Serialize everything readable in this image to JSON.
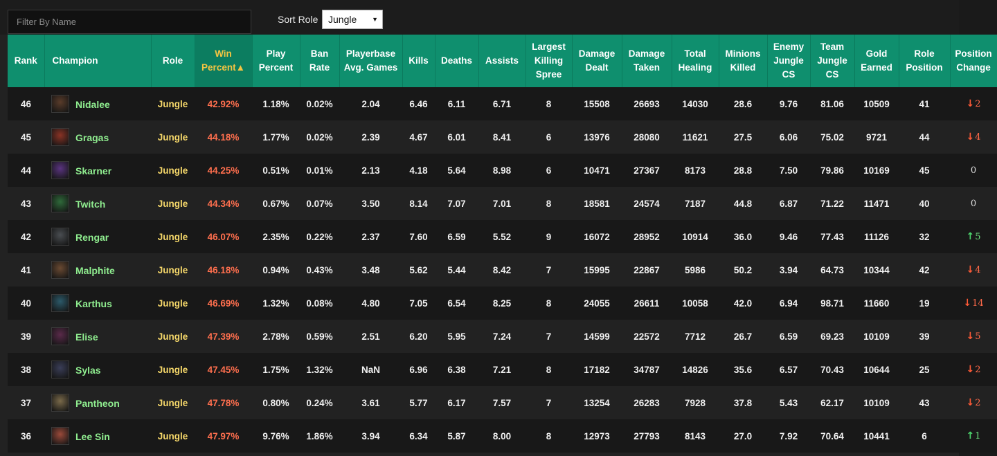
{
  "filter": {
    "placeholder": "Filter By Name",
    "value": ""
  },
  "sort": {
    "label": "Sort Role",
    "selected": "Jungle"
  },
  "columns": [
    {
      "label": "Rank"
    },
    {
      "label": "Champion"
    },
    {
      "label": "Role"
    },
    {
      "label": "Win Percent▲",
      "sorted": true
    },
    {
      "label": "Play Percent"
    },
    {
      "label": "Ban Rate"
    },
    {
      "label": "Playerbase Avg. Games"
    },
    {
      "label": "Kills"
    },
    {
      "label": "Deaths"
    },
    {
      "label": "Assists"
    },
    {
      "label": "Largest Killing Spree"
    },
    {
      "label": "Damage Dealt"
    },
    {
      "label": "Damage Taken"
    },
    {
      "label": "Total Healing"
    },
    {
      "label": "Minions Killed"
    },
    {
      "label": "Enemy Jungle CS"
    },
    {
      "label": "Team Jungle CS"
    },
    {
      "label": "Gold Earned"
    },
    {
      "label": "Role Position"
    },
    {
      "label": "Position Change"
    }
  ],
  "rows": [
    {
      "rank": "46",
      "champion": "Nidalee",
      "icon": "nidalee-portrait",
      "color": "#5a3c2a",
      "role": "Jungle",
      "win": "42.92%",
      "play": "1.18%",
      "ban": "0.02%",
      "avg_games": "2.04",
      "kills": "6.46",
      "deaths": "6.11",
      "assists": "6.71",
      "spree": "8",
      "dmg_dealt": "15508",
      "dmg_taken": "26693",
      "healing": "14030",
      "minions": "28.6",
      "enemy_jungle": "9.76",
      "team_jungle": "81.06",
      "gold": "10509",
      "role_pos": "41",
      "change": {
        "dir": "down",
        "value": "2"
      }
    },
    {
      "rank": "45",
      "champion": "Gragas",
      "icon": "gragas-portrait",
      "color": "#8a3325",
      "role": "Jungle",
      "win": "44.18%",
      "play": "1.77%",
      "ban": "0.02%",
      "avg_games": "2.39",
      "kills": "4.67",
      "deaths": "6.01",
      "assists": "8.41",
      "spree": "6",
      "dmg_dealt": "13976",
      "dmg_taken": "28080",
      "healing": "11621",
      "minions": "27.5",
      "enemy_jungle": "6.06",
      "team_jungle": "75.02",
      "gold": "9721",
      "role_pos": "44",
      "change": {
        "dir": "down",
        "value": "4"
      }
    },
    {
      "rank": "44",
      "champion": "Skarner",
      "icon": "skarner-portrait",
      "color": "#5a3480",
      "role": "Jungle",
      "win": "44.25%",
      "play": "0.51%",
      "ban": "0.01%",
      "avg_games": "2.13",
      "kills": "4.18",
      "deaths": "5.64",
      "assists": "8.98",
      "spree": "6",
      "dmg_dealt": "10471",
      "dmg_taken": "27367",
      "healing": "8173",
      "minions": "28.8",
      "enemy_jungle": "7.50",
      "team_jungle": "79.86",
      "gold": "10169",
      "role_pos": "45",
      "change": {
        "dir": "none",
        "value": "0"
      }
    },
    {
      "rank": "43",
      "champion": "Twitch",
      "icon": "twitch-portrait",
      "color": "#2f6a3a",
      "role": "Jungle",
      "win": "44.34%",
      "play": "0.67%",
      "ban": "0.07%",
      "avg_games": "3.50",
      "kills": "8.14",
      "deaths": "7.07",
      "assists": "7.01",
      "spree": "8",
      "dmg_dealt": "18581",
      "dmg_taken": "24574",
      "healing": "7187",
      "minions": "44.8",
      "enemy_jungle": "6.87",
      "team_jungle": "71.22",
      "gold": "11471",
      "role_pos": "40",
      "change": {
        "dir": "none",
        "value": "0"
      }
    },
    {
      "rank": "42",
      "champion": "Rengar",
      "icon": "rengar-portrait",
      "color": "#4a4e52",
      "role": "Jungle",
      "win": "46.07%",
      "play": "2.35%",
      "ban": "0.22%",
      "avg_games": "2.37",
      "kills": "7.60",
      "deaths": "6.59",
      "assists": "5.52",
      "spree": "9",
      "dmg_dealt": "16072",
      "dmg_taken": "28952",
      "healing": "10914",
      "minions": "36.0",
      "enemy_jungle": "9.46",
      "team_jungle": "77.43",
      "gold": "11126",
      "role_pos": "32",
      "change": {
        "dir": "up",
        "value": "5"
      }
    },
    {
      "rank": "41",
      "champion": "Malphite",
      "icon": "malphite-portrait",
      "color": "#6a4a32",
      "role": "Jungle",
      "win": "46.18%",
      "play": "0.94%",
      "ban": "0.43%",
      "avg_games": "3.48",
      "kills": "5.62",
      "deaths": "5.44",
      "assists": "8.42",
      "spree": "7",
      "dmg_dealt": "15995",
      "dmg_taken": "22867",
      "healing": "5986",
      "minions": "50.2",
      "enemy_jungle": "3.94",
      "team_jungle": "64.73",
      "gold": "10344",
      "role_pos": "42",
      "change": {
        "dir": "down",
        "value": "4"
      }
    },
    {
      "rank": "40",
      "champion": "Karthus",
      "icon": "karthus-portrait",
      "color": "#2c5a6a",
      "role": "Jungle",
      "win": "46.69%",
      "play": "1.32%",
      "ban": "0.08%",
      "avg_games": "4.80",
      "kills": "7.05",
      "deaths": "6.54",
      "assists": "8.25",
      "spree": "8",
      "dmg_dealt": "24055",
      "dmg_taken": "26611",
      "healing": "10058",
      "minions": "42.0",
      "enemy_jungle": "6.94",
      "team_jungle": "98.71",
      "gold": "11660",
      "role_pos": "19",
      "change": {
        "dir": "down",
        "value": "14"
      }
    },
    {
      "rank": "39",
      "champion": "Elise",
      "icon": "elise-portrait",
      "color": "#5a2a4a",
      "role": "Jungle",
      "win": "47.39%",
      "play": "2.78%",
      "ban": "0.59%",
      "avg_games": "2.51",
      "kills": "6.20",
      "deaths": "5.95",
      "assists": "7.24",
      "spree": "7",
      "dmg_dealt": "14599",
      "dmg_taken": "22572",
      "healing": "7712",
      "minions": "26.7",
      "enemy_jungle": "6.59",
      "team_jungle": "69.23",
      "gold": "10109",
      "role_pos": "39",
      "change": {
        "dir": "down",
        "value": "5"
      }
    },
    {
      "rank": "38",
      "champion": "Sylas",
      "icon": "sylas-portrait",
      "color": "#3a3e58",
      "role": "Jungle",
      "win": "47.45%",
      "play": "1.75%",
      "ban": "1.32%",
      "avg_games": "NaN",
      "kills": "6.96",
      "deaths": "6.38",
      "assists": "7.21",
      "spree": "8",
      "dmg_dealt": "17182",
      "dmg_taken": "34787",
      "healing": "14826",
      "minions": "35.6",
      "enemy_jungle": "6.57",
      "team_jungle": "70.43",
      "gold": "10644",
      "role_pos": "25",
      "change": {
        "dir": "down",
        "value": "2"
      }
    },
    {
      "rank": "37",
      "champion": "Pantheon",
      "icon": "pantheon-portrait",
      "color": "#7a6a4a",
      "role": "Jungle",
      "win": "47.78%",
      "play": "0.80%",
      "ban": "0.24%",
      "avg_games": "3.61",
      "kills": "5.77",
      "deaths": "6.17",
      "assists": "7.57",
      "spree": "7",
      "dmg_dealt": "13254",
      "dmg_taken": "26283",
      "healing": "7928",
      "minions": "37.8",
      "enemy_jungle": "5.43",
      "team_jungle": "62.17",
      "gold": "10109",
      "role_pos": "43",
      "change": {
        "dir": "down",
        "value": "2"
      }
    },
    {
      "rank": "36",
      "champion": "Lee Sin",
      "icon": "lee-sin-portrait",
      "color": "#9a4a3a",
      "role": "Jungle",
      "win": "47.97%",
      "play": "9.76%",
      "ban": "1.86%",
      "avg_games": "3.94",
      "kills": "6.34",
      "deaths": "5.87",
      "assists": "8.00",
      "spree": "8",
      "dmg_dealt": "12973",
      "dmg_taken": "27793",
      "healing": "8143",
      "minions": "27.0",
      "enemy_jungle": "7.92",
      "team_jungle": "70.64",
      "gold": "10441",
      "role_pos": "6",
      "change": {
        "dir": "up",
        "value": "1"
      }
    }
  ]
}
